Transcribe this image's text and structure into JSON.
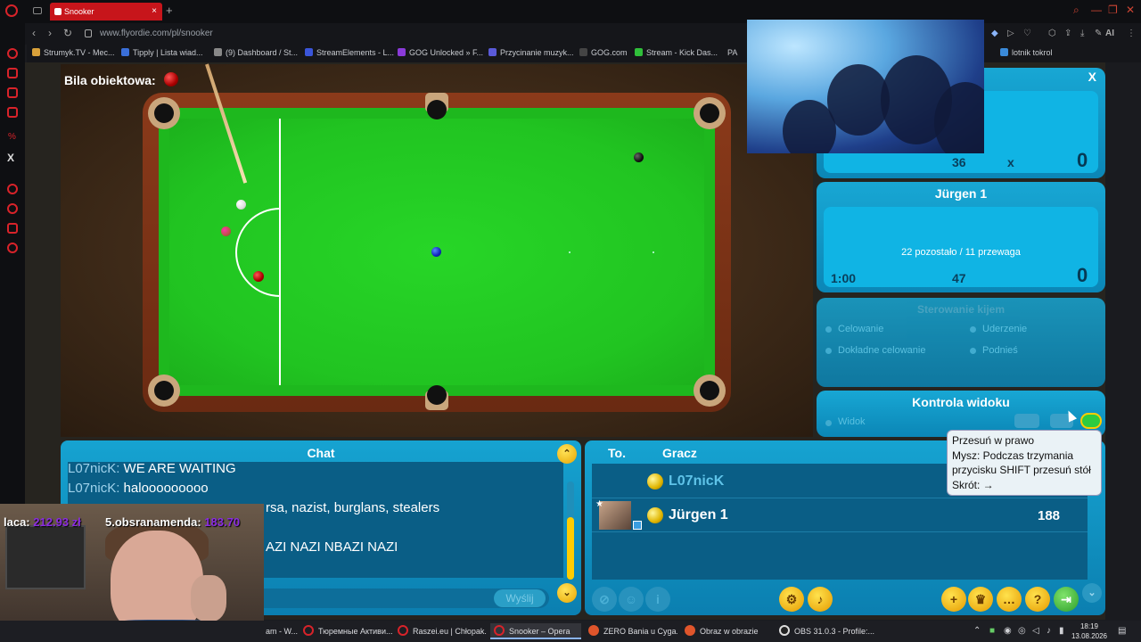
{
  "browser": {
    "tab_title": "Snooker",
    "url": "www.flyordie.com/pl/snooker",
    "bookmarks": [
      "Strumyk.TV - Mec...",
      "Tipply | Lista wiad...",
      "(9) Dashboard / St...",
      "StreamElements - L...",
      "GOG Unlocked » F...",
      "Przycinanie muzyk...",
      "GOG.com",
      "Stream - Kick Das...",
      "PA",
      "lotnik tokrol"
    ],
    "addr_ai": "AI"
  },
  "game": {
    "object_ball_label": "Bila obiektowa:",
    "opponent_panel": {
      "close_glyph": "X",
      "count": "36",
      "x": "x",
      "score": "0"
    },
    "player_panel": {
      "name": "Jürgen 1",
      "status": "22 pozostało / 11 przewaga",
      "time": "1:00",
      "count": "47",
      "score": "0"
    },
    "cue_panel": {
      "title": "Sterowanie kijem",
      "opt1": "Celowanie",
      "opt2": "Uderzenie",
      "opt3": "Dokładne celowanie",
      "opt4": "Podnieś"
    },
    "view_panel": {
      "title": "Kontrola widoku",
      "option": "Widok"
    },
    "tooltip": {
      "line1": "Przesuń w prawo",
      "line2": "Mysz: Podczas trzymania",
      "line3": "przycisku SHIFT przesuń stół",
      "line4": "Skrót: →"
    },
    "chat": {
      "title": "Chat",
      "messages": [
        {
          "nick": "L07nicK:",
          "text": "WE ARE WAITING"
        },
        {
          "nick": "L07nicK:",
          "text": "halooooooooo"
        },
        {
          "nick": "",
          "text": "rsa, nazist, burglans, stealers"
        },
        {
          "nick": "",
          "text": "AZI NAZI NBAZI NAZI"
        }
      ],
      "send_label": "Wyślij"
    },
    "players": {
      "col_to": "To.",
      "col_player": "Gracz",
      "rows": [
        {
          "name": "L07nicK",
          "score": ""
        },
        {
          "name": "Jürgen 1",
          "score": "188"
        }
      ]
    }
  },
  "stream_overlay": {
    "left_name": "laca:",
    "left_amount": "212.93 zł",
    "right_name": "5.obsranamenda:",
    "right_amount": "183.70"
  },
  "taskbar": {
    "items": [
      "am - W...",
      "Тюремные Активи...",
      "Raszei.eu | Chłopak...",
      "Snooker – Opera",
      "ZERO Bania u Cyga...",
      "Obraz w obrazie",
      "OBS 31.0.3 - Profile:..."
    ],
    "time": "18:19",
    "date": "13.08.2026"
  },
  "colors": {
    "accent_red": "#d8232a",
    "panel_blue": "#10b4e4",
    "felt_green": "#21c421",
    "button_yellow": "#ffcc00"
  }
}
